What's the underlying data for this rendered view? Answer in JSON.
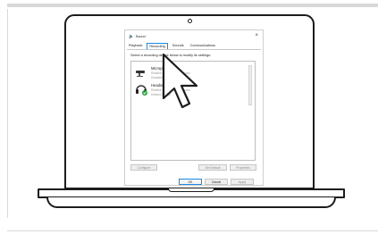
{
  "dialog": {
    "title": "Sound",
    "close_glyph": "×",
    "tabs": [
      {
        "label": "Playback",
        "active": false
      },
      {
        "label": "Recording",
        "active": true
      },
      {
        "label": "Sounds",
        "active": false
      },
      {
        "label": "Communications",
        "active": false
      }
    ],
    "instruction": "Select a recording device below to modify its settings:",
    "devices": [
      {
        "name": "Microphone",
        "line1": "Realtek High Definition Audio",
        "line2": "Disabled",
        "icon": "microphone-icon"
      },
      {
        "name": "Headset",
        "line1": "Realtek High Definition Audio",
        "line2": "Default Device",
        "icon": "headset-icon",
        "default": true
      }
    ],
    "buttons": {
      "configure": "Configure",
      "set_default": "Set Default",
      "properties": "Properties",
      "ok": "OK",
      "cancel": "Cancel",
      "apply": "Apply"
    }
  },
  "colors": {
    "accent": "#1e88e5",
    "check": "#2e9e3e",
    "outline": "#1c1c1c"
  }
}
